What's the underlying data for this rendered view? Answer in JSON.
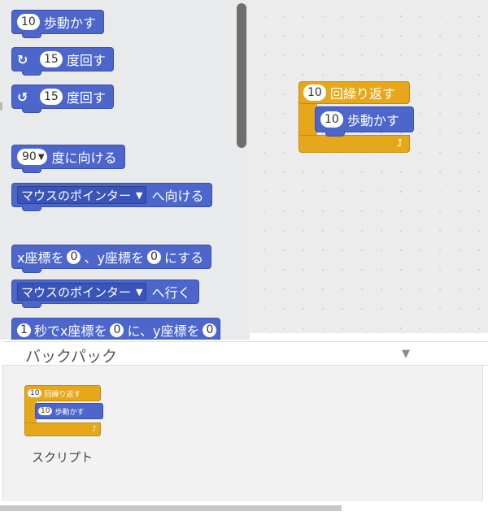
{
  "palette": {
    "move": {
      "num": "10",
      "label": "歩動かす"
    },
    "turn_right": {
      "icon": "rotate-right-icon",
      "num": "15",
      "label": "度回す"
    },
    "turn_left": {
      "icon": "rotate-left-icon",
      "num": "15",
      "label": "度回す"
    },
    "point_direction": {
      "value": "90",
      "label": "度に向ける"
    },
    "point_towards": {
      "dropdown": "マウスのポインター",
      "label": "へ向ける"
    },
    "goto_xy": {
      "x_label": "x座標を",
      "x": "0",
      "sep": "、y座標を",
      "y": "0",
      "label": "にする"
    },
    "goto": {
      "dropdown": "マウスのポインター",
      "label": "へ行く"
    },
    "glide": {
      "secs": "1",
      "secs_label": "秒でx座標を",
      "x": "0",
      "mid": "に、y座標を",
      "y": "0"
    }
  },
  "script": {
    "repeat": {
      "num": "10",
      "label": "回繰り返す"
    },
    "inner_move": {
      "num": "10",
      "label": "歩動かす"
    }
  },
  "backpack": {
    "title": "バックパック",
    "item_label": "スクリプト",
    "thumb_repeat_num": "10",
    "thumb_repeat_label": "回繰り返す",
    "thumb_move_num": "10",
    "thumb_move_label": "歩動かす"
  },
  "colors": {
    "motion": "#4c66cc",
    "control": "#e6a71a"
  }
}
